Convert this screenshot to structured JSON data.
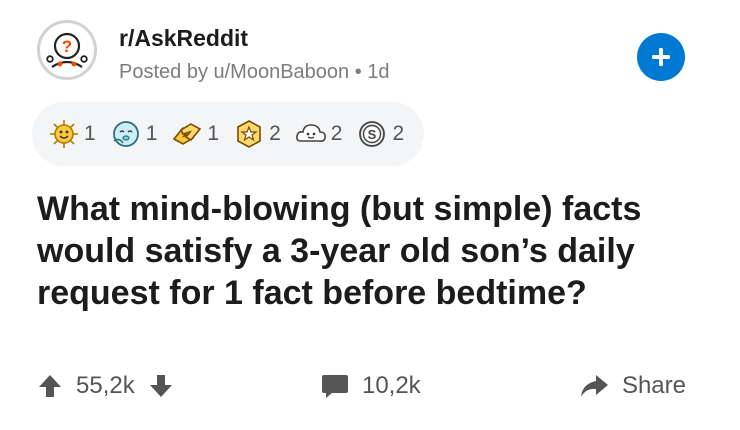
{
  "header": {
    "subreddit": "r/AskReddit",
    "posted_by": "Posted by u/MoonBaboon",
    "separator": "•",
    "age": "1d",
    "avatar_icon": "askreddit-icon",
    "join_icon": "plus-icon"
  },
  "awards": [
    {
      "icon": "sun-face-award-icon",
      "count": "1"
    },
    {
      "icon": "blushing-award-icon",
      "count": "1"
    },
    {
      "icon": "fist-bump-award-icon",
      "count": "1"
    },
    {
      "icon": "star-award-icon",
      "count": "2"
    },
    {
      "icon": "cloud-face-award-icon",
      "count": "2"
    },
    {
      "icon": "silver-award-icon",
      "count": "2"
    }
  ],
  "post": {
    "title": "What mind-blowing (but simple) facts would satisfy a 3-year old son’s daily request for 1 fact before bedtime?"
  },
  "footer": {
    "upvotes": "55,2k",
    "comments": "10,2k",
    "share_label": "Share"
  },
  "colors": {
    "accent": "#0079d3",
    "text": "#1c1c1c",
    "muted": "#7c7c7c",
    "award_bg": "#f4f5f6"
  }
}
